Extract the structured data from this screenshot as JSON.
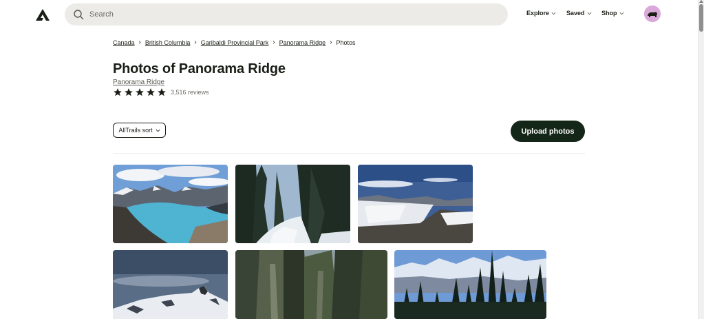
{
  "header": {
    "logo_icon": "alltrails-logo-icon",
    "search": {
      "placeholder": "Search",
      "icon": "search-icon"
    },
    "nav": [
      {
        "label": "Explore"
      },
      {
        "label": "Saved"
      },
      {
        "label": "Shop"
      }
    ],
    "avatar_icon": "bear-avatar-icon"
  },
  "breadcrumb": {
    "items": [
      "Canada",
      "British Columbia",
      "Garibaldi Provincial Park",
      "Panorama Ridge"
    ],
    "current": "Photos",
    "separator": "›"
  },
  "page": {
    "title": "Photos of Panorama Ridge",
    "subtitle": "Panorama Ridge",
    "rating_stars": 5,
    "reviews": "3,516 reviews"
  },
  "toolbar": {
    "sort_label": "AllTrails sort",
    "upload_label": "Upload photos"
  },
  "colors": {
    "primary_button": "#142617",
    "search_bg": "#ecebe8",
    "text": "#1a1f16"
  },
  "photos": [
    {
      "name": "photo-garibaldi-lake"
    },
    {
      "name": "photo-forest-snow-trail"
    },
    {
      "name": "photo-snowy-ridge-clouds"
    },
    {
      "name": "photo-black-tusk-peak"
    },
    {
      "name": "photo-forest-trees"
    },
    {
      "name": "photo-mountain-range-pines"
    }
  ]
}
